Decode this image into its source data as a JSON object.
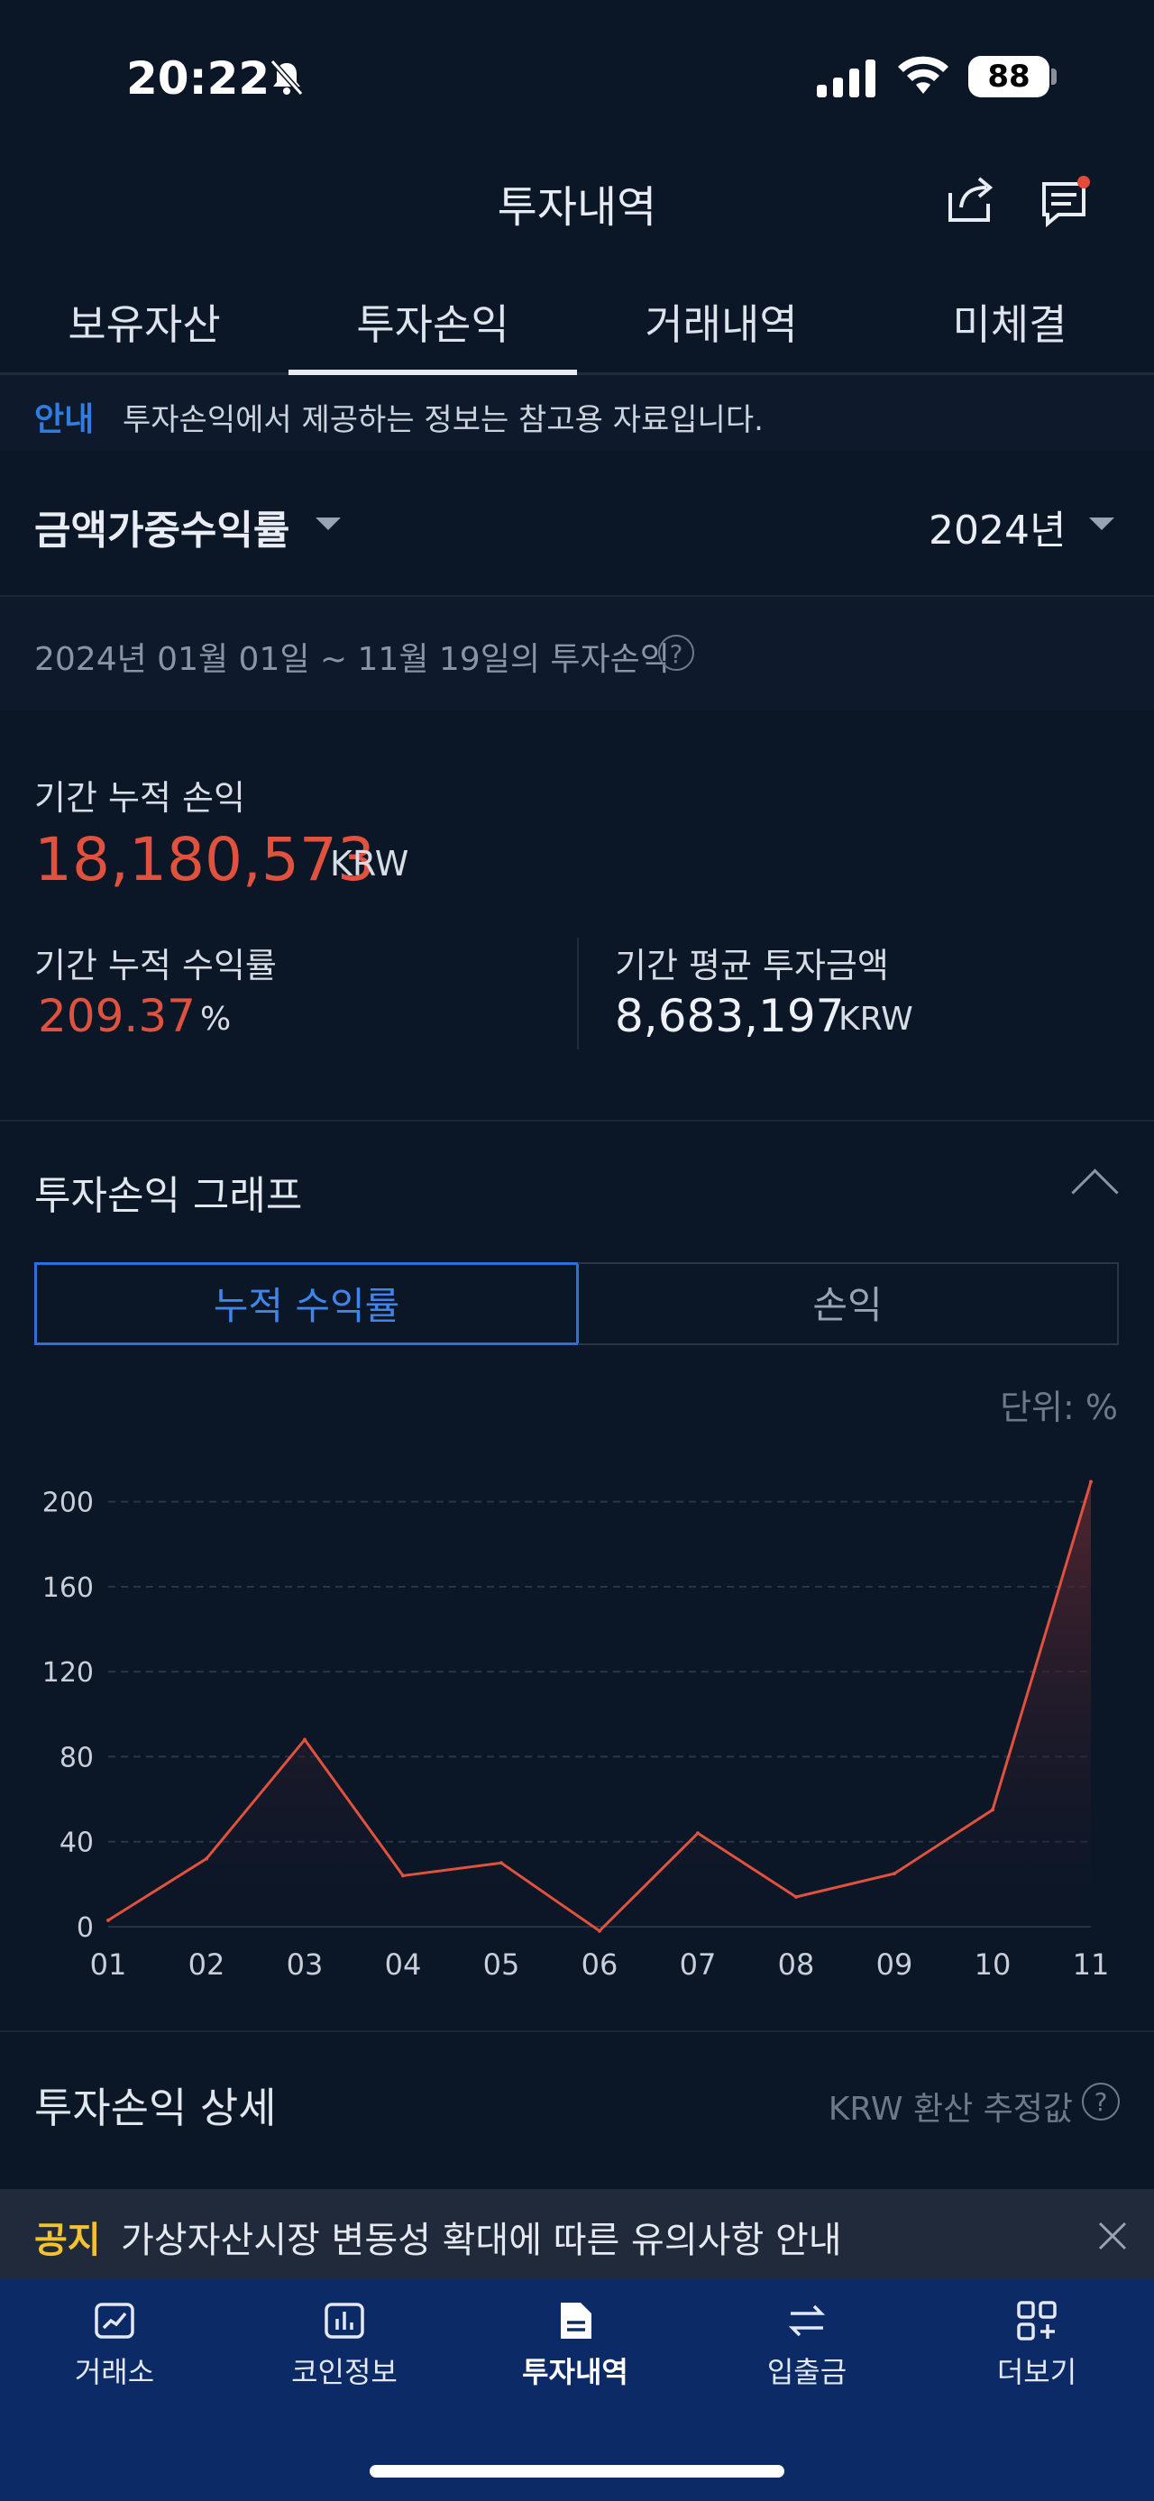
{
  "status_bar": {
    "time": "20:22",
    "battery": "88"
  },
  "header": {
    "title": "투자내역"
  },
  "tabs": [
    {
      "label": "보유자산"
    },
    {
      "label": "투자손익"
    },
    {
      "label": "거래내역"
    },
    {
      "label": "미체결"
    }
  ],
  "notice": {
    "label": "안내",
    "text": "투자손익에서 제공하는 정보는 참고용 자료입니다."
  },
  "filters": {
    "metric": "금액가중수익률",
    "year": "2024년"
  },
  "period": {
    "text": "2024년 01월 01일 ~ 11월 19일의 투자손익"
  },
  "summary": {
    "cum_pl_label": "기간 누적 손익",
    "cum_pl_value": "18,180,573",
    "cum_pl_unit": "KRW",
    "cum_rate_label": "기간 누적 수익률",
    "cum_rate_value": "209.37",
    "cum_rate_unit": "%",
    "avg_invest_label": "기간 평균 투자금액",
    "avg_invest_value": "8,683,197",
    "avg_invest_unit": "KRW"
  },
  "graph": {
    "title": "투자손익 그래프",
    "toggle_cum": "누적 수익률",
    "toggle_pl": "손익",
    "unit": "단위: %"
  },
  "chart_data": {
    "type": "area",
    "categories": [
      "01",
      "02",
      "03",
      "04",
      "05",
      "06",
      "07",
      "08",
      "09",
      "10",
      "11"
    ],
    "values": [
      3,
      32,
      88,
      24,
      30,
      -2,
      44,
      14,
      25,
      55,
      209.37
    ],
    "yticks": [
      0,
      40,
      80,
      120,
      160,
      200
    ],
    "ylim": [
      0,
      210
    ],
    "grid": true,
    "colors": {
      "line": "#e0523d",
      "fill": "#5a2730",
      "grid": "#2b3648"
    }
  },
  "detail": {
    "title": "투자손익 상세",
    "note": "KRW 환산 추정값"
  },
  "announcement": {
    "label": "공지",
    "text": "가상자산시장 변동성 확대에 따른 유의사항 안내"
  },
  "bottom_nav": [
    {
      "label": "거래소",
      "icon": "chart-up-icon"
    },
    {
      "label": "코인정보",
      "icon": "bar-chart-icon"
    },
    {
      "label": "투자내역",
      "icon": "document-icon",
      "active": true
    },
    {
      "label": "입출금",
      "icon": "transfer-icon"
    },
    {
      "label": "더보기",
      "icon": "grid-plus-icon"
    }
  ]
}
